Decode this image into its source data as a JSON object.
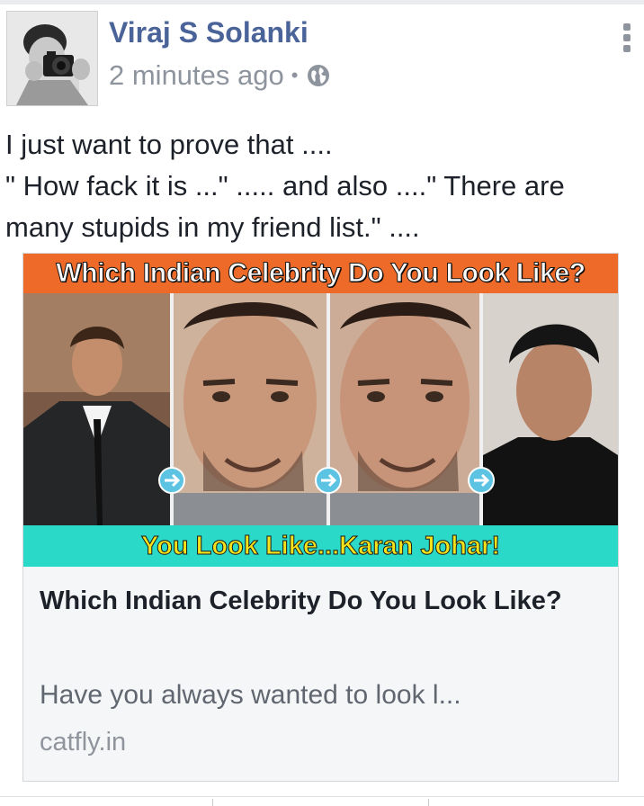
{
  "post": {
    "author": "Viraj S Solanki",
    "timestamp": "2 minutes ago",
    "separator": "•",
    "privacy_icon": "globe-icon",
    "lines": [
      "I just want to prove that ....",
      "\" How fack it is ...\" ..... and also ....\" There are",
      "many stupids in my friend list.\" ...."
    ]
  },
  "link_card": {
    "banner_top": "Which Indian Celebrity Do You Look Like?",
    "banner_bottom": "You Look Like...Karan Johar!",
    "title": "Which Indian Celebrity Do You Look Like?",
    "description": "Have you always wanted to look l...",
    "domain": "catfly.in"
  },
  "colors": {
    "author": "#4a6399",
    "banner_top": "#ee6a28",
    "banner_bottom": "#2ad9c7",
    "banner_bottom_text": "#f4e21a"
  }
}
